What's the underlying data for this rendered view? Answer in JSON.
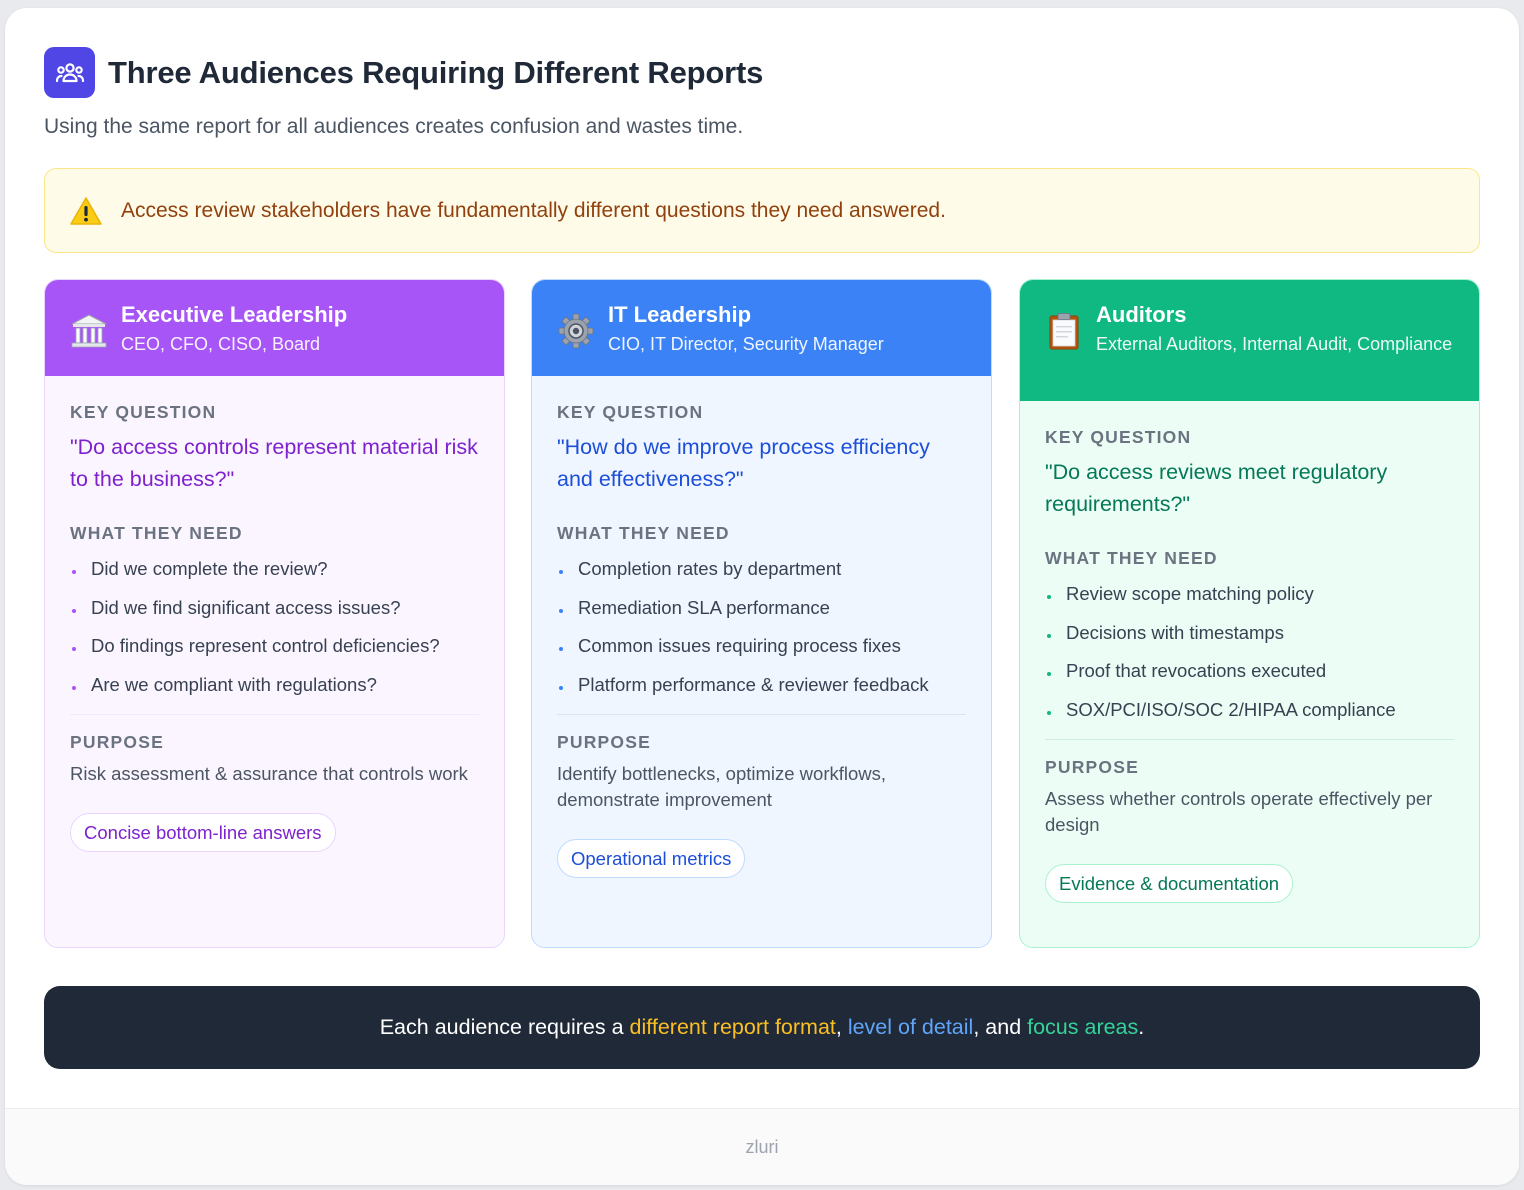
{
  "header": {
    "icon": "users-group-icon",
    "title": "Three Audiences Requiring Different Reports",
    "subtitle": "Using the same report for all audiences creates confusion and wastes time."
  },
  "alert": {
    "icon": "warning-icon",
    "text": "Access review stakeholders have fundamentally different questions they need answered."
  },
  "labels": {
    "key_question": "KEY QUESTION",
    "what_they_need": "WHAT THEY NEED",
    "purpose": "PURPOSE"
  },
  "cards": [
    {
      "icon": "bank-building-icon",
      "name": "Executive Leadership",
      "roles": "CEO, CFO, CISO, Board",
      "question": "\"Do access controls represent material risk to the business?\"",
      "needs": [
        "Did we complete the review?",
        "Did we find significant access issues?",
        "Do findings represent control deficiencies?",
        "Are we compliant with regulations?"
      ],
      "purpose": "Risk assessment & assurance that controls work",
      "tag": "Concise bottom-line answers",
      "color": "#a855f7"
    },
    {
      "icon": "gear-icon",
      "name": "IT Leadership",
      "roles": "CIO, IT Director, Security Manager",
      "question": "\"How do we improve process efficiency and effectiveness?\"",
      "needs": [
        "Completion rates by department",
        "Remediation SLA performance",
        "Common issues requiring process fixes",
        "Platform performance & reviewer feedback"
      ],
      "purpose": "Identify bottlenecks, optimize workflows, demonstrate improvement",
      "tag": "Operational metrics",
      "color": "#3b82f6"
    },
    {
      "icon": "clipboard-icon",
      "name": "Auditors",
      "roles": "External Auditors, Internal Audit, Compliance",
      "question": "\"Do access reviews meet regulatory requirements?\"",
      "needs": [
        "Review scope matching policy",
        "Decisions with timestamps",
        "Proof that revocations executed",
        "SOX/PCI/ISO/SOC 2/HIPAA compliance"
      ],
      "purpose": "Assess whether controls operate effectively per design",
      "tag": "Evidence & documentation",
      "color": "#10b981"
    }
  ],
  "banner": {
    "prefix": "Each audience requires a ",
    "highlight_1": "different report format",
    "sep_1": ", ",
    "highlight_2": "level of detail",
    "sep_2": ", and ",
    "highlight_3": "focus areas",
    "suffix": "."
  },
  "footer": {
    "brand": "zluri"
  }
}
